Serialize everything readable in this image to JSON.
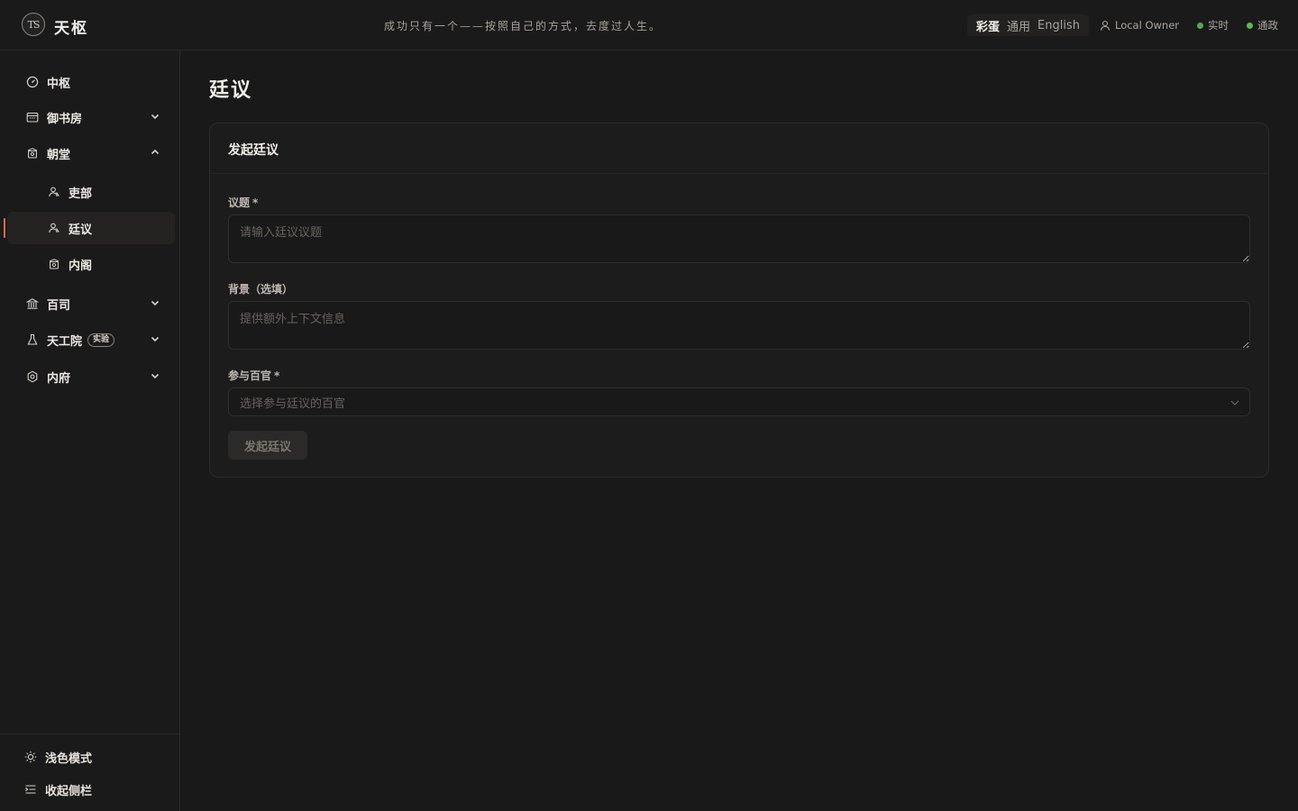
{
  "app": {
    "logo_text": "TS",
    "title": "天枢",
    "motto": "成功只有一个——按照自己的方式，去度过人生。"
  },
  "header": {
    "lang_options": [
      "彩蛋",
      "通用",
      "English"
    ],
    "lang_active": "彩蛋",
    "owner": "Local Owner",
    "status_live": "实时",
    "status_gov": "通政",
    "status_color": "#4caf50"
  },
  "sidebar": {
    "items": [
      {
        "label": "中枢",
        "icon": "dashboard-icon"
      },
      {
        "label": "御书房",
        "icon": "calendar-icon",
        "chevron": "down"
      },
      {
        "label": "朝堂",
        "icon": "hall-icon",
        "chevron": "up"
      },
      {
        "label": "吏部",
        "icon": "people-icon",
        "sub": true
      },
      {
        "label": "廷议",
        "icon": "people-icon",
        "sub": true,
        "active": true
      },
      {
        "label": "内阁",
        "icon": "hall-icon",
        "sub": true
      },
      {
        "label": "百司",
        "icon": "bank-icon",
        "chevron": "down"
      },
      {
        "label": "天工院",
        "icon": "flask-icon",
        "chevron": "down",
        "badge": "实验"
      },
      {
        "label": "内府",
        "icon": "settings-icon",
        "chevron": "down"
      }
    ],
    "footer": {
      "theme_toggle": "浅色模式",
      "collapse": "收起侧栏"
    },
    "accent_color": "#d86b4c"
  },
  "main": {
    "page_title": "廷议",
    "card": {
      "title": "发起廷议",
      "topic_label": "议题",
      "topic_required": "*",
      "topic_placeholder": "请输入廷议议题",
      "background_label": "背景（选填）",
      "background_placeholder": "提供额外上下文信息",
      "officials_label": "参与百官",
      "officials_required": "*",
      "officials_placeholder": "选择参与廷议的百官",
      "submit_label": "发起廷议"
    }
  }
}
